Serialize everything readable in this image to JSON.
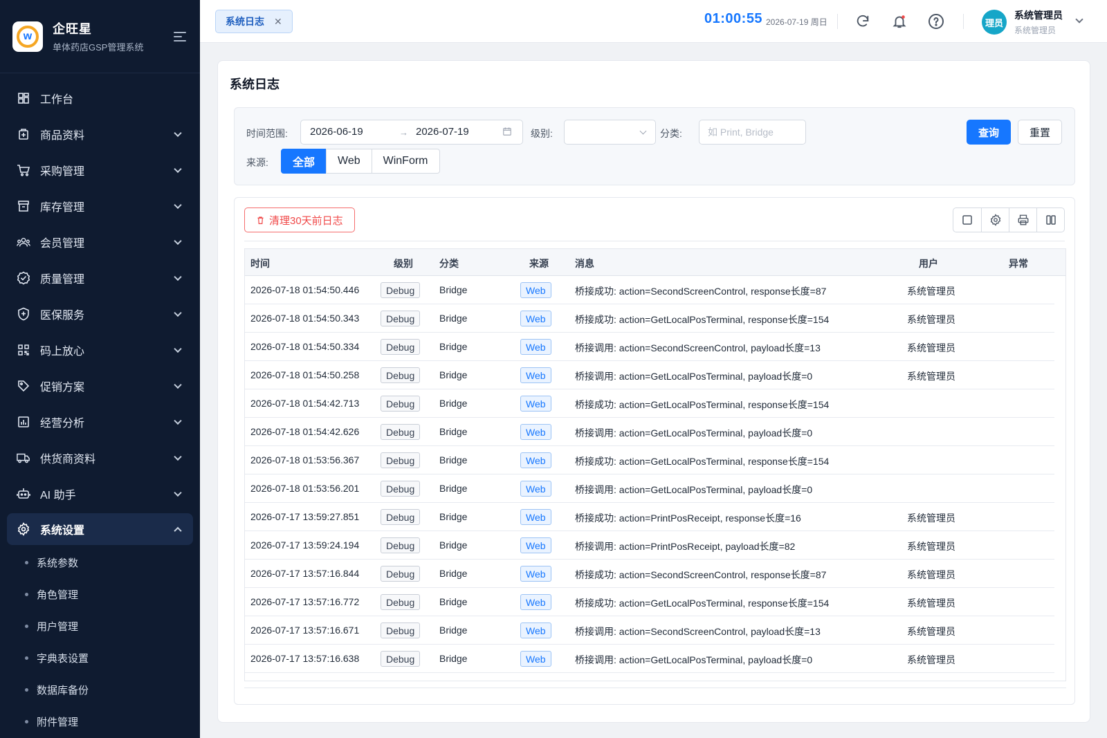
{
  "brand": {
    "name": "企旺星",
    "subtitle": "单体药店GSP管理系统",
    "logo_icon": "w-logo"
  },
  "sidebar": {
    "items": [
      {
        "label": "工作台",
        "icon": "dashboard-icon",
        "expandable": false
      },
      {
        "label": "商品资料",
        "icon": "product-icon",
        "expandable": true
      },
      {
        "label": "采购管理",
        "icon": "cart-icon",
        "expandable": true
      },
      {
        "label": "库存管理",
        "icon": "archive-icon",
        "expandable": true
      },
      {
        "label": "会员管理",
        "icon": "members-icon",
        "expandable": true
      },
      {
        "label": "质量管理",
        "icon": "quality-icon",
        "expandable": true
      },
      {
        "label": "医保服务",
        "icon": "shield-icon",
        "expandable": true
      },
      {
        "label": "码上放心",
        "icon": "qrcode-icon",
        "expandable": true
      },
      {
        "label": "促销方案",
        "icon": "tag-icon",
        "expandable": true
      },
      {
        "label": "经营分析",
        "icon": "chart-icon",
        "expandable": true
      },
      {
        "label": "供货商资料",
        "icon": "truck-icon",
        "expandable": true
      },
      {
        "label": "AI 助手",
        "icon": "robot-icon",
        "expandable": true
      },
      {
        "label": "系统设置",
        "icon": "gear-icon",
        "expandable": true,
        "active": true
      }
    ],
    "submenu": [
      "系统参数",
      "角色管理",
      "用户管理",
      "字典表设置",
      "数据库备份",
      "附件管理"
    ]
  },
  "header": {
    "tab_label": "系统日志",
    "clock": "01:00:55",
    "date": "2026-07-19 周日",
    "user_name": "系统管理员",
    "user_role": "系统管理员",
    "avatar_text": "理员",
    "avatar_color": "#16a6c8"
  },
  "page": {
    "title": "系统日志",
    "filter": {
      "time_label": "时间范围:",
      "date_start": "2026-06-19",
      "date_end": "2026-07-19",
      "level_label": "级别:",
      "level_value": "",
      "category_label": "分类:",
      "category_placeholder": "如 Print, Bridge",
      "source_label": "来源:",
      "source_options": [
        "全部",
        "Web",
        "WinForm"
      ],
      "source_selected": "全部",
      "query_label": "查询",
      "reset_label": "重置"
    },
    "clear_button": "清理30天前日志",
    "columns": [
      "时间",
      "级别",
      "分类",
      "来源",
      "消息",
      "用户",
      "异常"
    ],
    "rows": [
      {
        "time": "2026-07-18 01:54:50.446",
        "level": "Debug",
        "category": "Bridge",
        "source": "Web",
        "message": "桥接成功: action=SecondScreenControl, response长度=87",
        "user": "系统管理员",
        "exception": ""
      },
      {
        "time": "2026-07-18 01:54:50.343",
        "level": "Debug",
        "category": "Bridge",
        "source": "Web",
        "message": "桥接成功: action=GetLocalPosTerminal, response长度=154",
        "user": "系统管理员",
        "exception": ""
      },
      {
        "time": "2026-07-18 01:54:50.334",
        "level": "Debug",
        "category": "Bridge",
        "source": "Web",
        "message": "桥接调用: action=SecondScreenControl, payload长度=13",
        "user": "系统管理员",
        "exception": ""
      },
      {
        "time": "2026-07-18 01:54:50.258",
        "level": "Debug",
        "category": "Bridge",
        "source": "Web",
        "message": "桥接调用: action=GetLocalPosTerminal, payload长度=0",
        "user": "系统管理员",
        "exception": ""
      },
      {
        "time": "2026-07-18 01:54:42.713",
        "level": "Debug",
        "category": "Bridge",
        "source": "Web",
        "message": "桥接成功: action=GetLocalPosTerminal, response长度=154",
        "user": "",
        "exception": ""
      },
      {
        "time": "2026-07-18 01:54:42.626",
        "level": "Debug",
        "category": "Bridge",
        "source": "Web",
        "message": "桥接调用: action=GetLocalPosTerminal, payload长度=0",
        "user": "",
        "exception": ""
      },
      {
        "time": "2026-07-18 01:53:56.367",
        "level": "Debug",
        "category": "Bridge",
        "source": "Web",
        "message": "桥接成功: action=GetLocalPosTerminal, response长度=154",
        "user": "",
        "exception": ""
      },
      {
        "time": "2026-07-18 01:53:56.201",
        "level": "Debug",
        "category": "Bridge",
        "source": "Web",
        "message": "桥接调用: action=GetLocalPosTerminal, payload长度=0",
        "user": "",
        "exception": ""
      },
      {
        "time": "2026-07-17 13:59:27.851",
        "level": "Debug",
        "category": "Bridge",
        "source": "Web",
        "message": "桥接成功: action=PrintPosReceipt, response长度=16",
        "user": "系统管理员",
        "exception": ""
      },
      {
        "time": "2026-07-17 13:59:24.194",
        "level": "Debug",
        "category": "Bridge",
        "source": "Web",
        "message": "桥接调用: action=PrintPosReceipt, payload长度=82",
        "user": "系统管理员",
        "exception": ""
      },
      {
        "time": "2026-07-17 13:57:16.844",
        "level": "Debug",
        "category": "Bridge",
        "source": "Web",
        "message": "桥接成功: action=SecondScreenControl, response长度=87",
        "user": "系统管理员",
        "exception": ""
      },
      {
        "time": "2026-07-17 13:57:16.772",
        "level": "Debug",
        "category": "Bridge",
        "source": "Web",
        "message": "桥接成功: action=GetLocalPosTerminal, response长度=154",
        "user": "系统管理员",
        "exception": ""
      },
      {
        "time": "2026-07-17 13:57:16.671",
        "level": "Debug",
        "category": "Bridge",
        "source": "Web",
        "message": "桥接调用: action=SecondScreenControl, payload长度=13",
        "user": "系统管理员",
        "exception": ""
      },
      {
        "time": "2026-07-17 13:57:16.638",
        "level": "Debug",
        "category": "Bridge",
        "source": "Web",
        "message": "桥接调用: action=GetLocalPosTerminal, payload长度=0",
        "user": "系统管理员",
        "exception": ""
      }
    ]
  },
  "colors": {
    "accent": "#1677ff",
    "sidebar_bg": "#0f1b30",
    "danger": "#f04848"
  }
}
